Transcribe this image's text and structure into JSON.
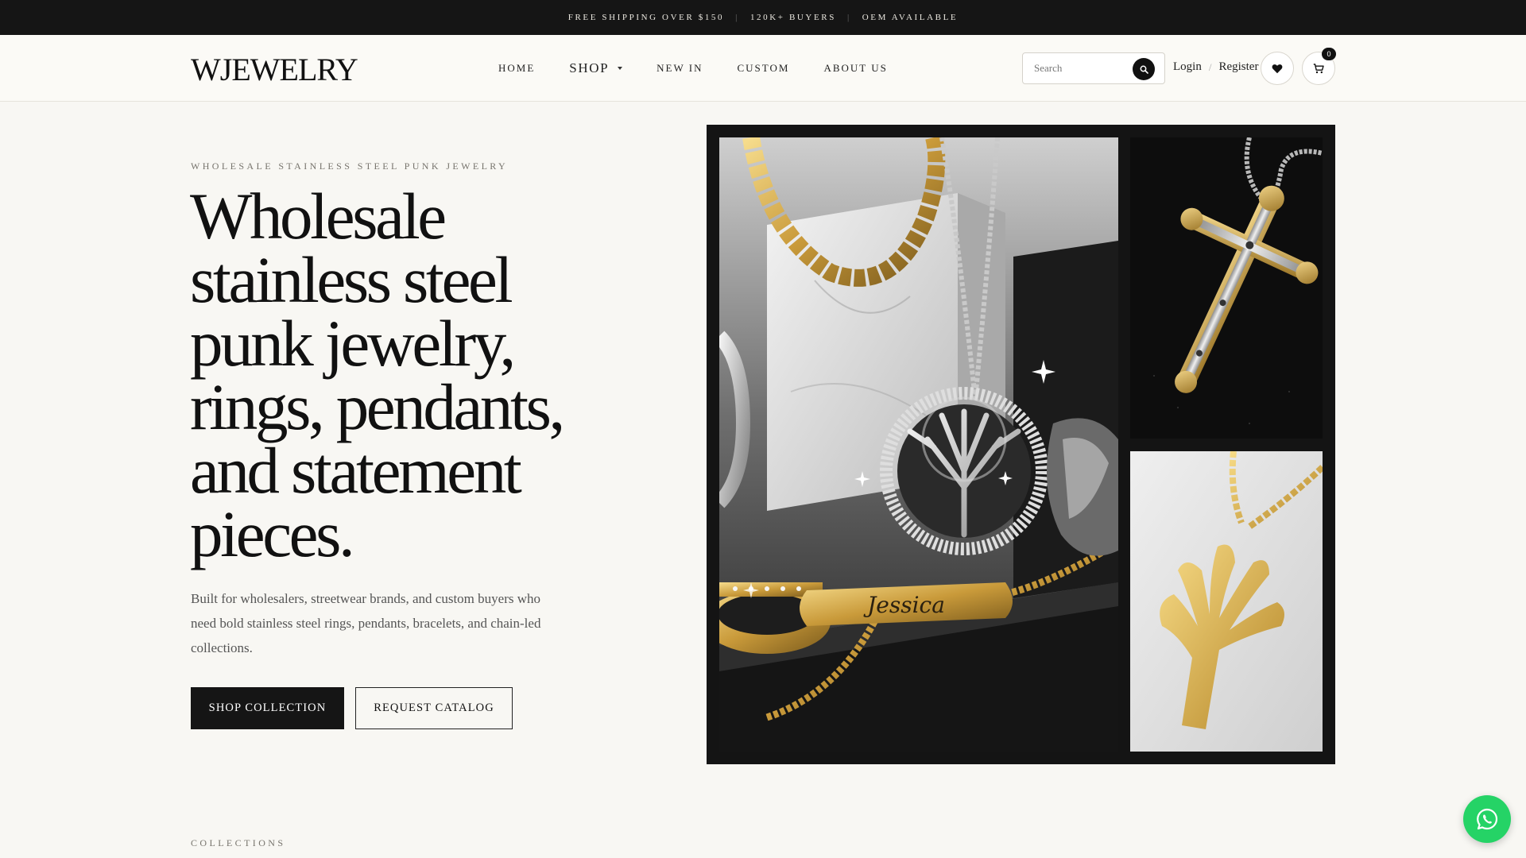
{
  "announcement": {
    "items": [
      "FREE SHIPPING OVER $150",
      "120K+ BUYERS",
      "OEM AVAILABLE"
    ],
    "separator": "|"
  },
  "header": {
    "logo": "WJEWELRY",
    "nav": [
      {
        "label": "HOME"
      },
      {
        "label": "SHOP"
      },
      {
        "label": "NEW IN"
      },
      {
        "label": "CUSTOM"
      },
      {
        "label": "ABOUT US"
      }
    ],
    "search": {
      "placeholder": "Search"
    },
    "account": {
      "login": "Login",
      "separator": "/",
      "register": "Register"
    },
    "cart_count": "0",
    "icons": {
      "search": "search-icon",
      "wishlist": "heart-icon",
      "cart": "cart-icon",
      "shop_dropdown": "chevron-down-icon"
    }
  },
  "hero": {
    "eyebrow": "WHOLESALE STAINLESS STEEL PUNK JEWELRY",
    "headline": "Wholesale stainless steel punk jewelry, rings, pendants, and statement pieces.",
    "description": "Built for wholesalers, streetwear brands, and custom buyers who need bold stainless steel rings, pendants, bracelets, and chain-led collections.",
    "primary_cta": "SHOP COLLECTION",
    "secondary_cta": "REQUEST CATALOG"
  },
  "gallery": {
    "engraving": "Jessica"
  },
  "collections": {
    "label": "COLLECTIONS"
  },
  "colors": {
    "topbar": "#151515",
    "background": "#f8f7f3",
    "primary": "#151515",
    "whatsapp": "#25d366"
  },
  "floating": {
    "whatsapp_icon": "whatsapp-icon"
  }
}
